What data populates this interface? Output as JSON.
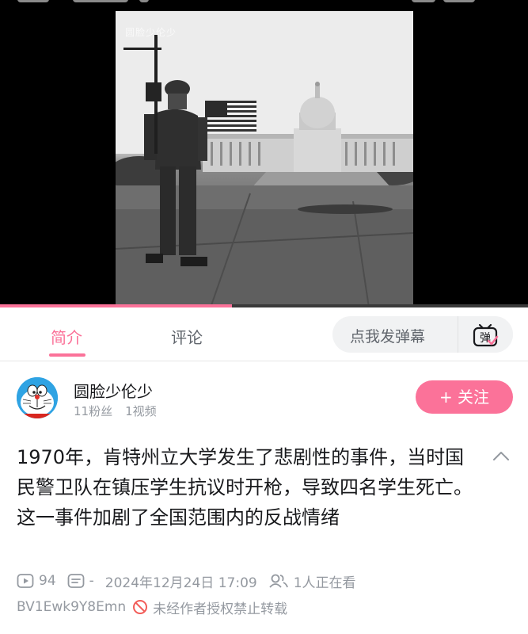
{
  "video": {
    "watermark": "圆脸少伦少",
    "progress": 0.44
  },
  "tabs": [
    {
      "label": "简介",
      "active": true
    },
    {
      "label": "评论",
      "active": false
    }
  ],
  "danmaku": {
    "placeholder": "点我发弹幕",
    "button_icon": "danmaku-toggle-icon",
    "button_glyph": "弹"
  },
  "uploader": {
    "name": "圆脸少伦少",
    "fans": "11粉丝",
    "videos": "1视频",
    "follow_label": "+ 关注"
  },
  "description": "1970年，肯特州立大学发生了悲剧性的事件，当时国民警卫队在镇压学生抗议时开枪，导致四名学生死亡。这一事件加剧了全国范围内的反战情绪",
  "meta": {
    "plays": "94",
    "danmaku_count": "-",
    "date": "2024年12月24日 17:09",
    "watching": "1人正在看"
  },
  "bvid": "BV1Ewk9Y8Emn",
  "copyright_notice": "未经作者授权禁止转载",
  "colors": {
    "accent": "#fb7299",
    "muted": "#9499a0",
    "text": "#18191c"
  }
}
